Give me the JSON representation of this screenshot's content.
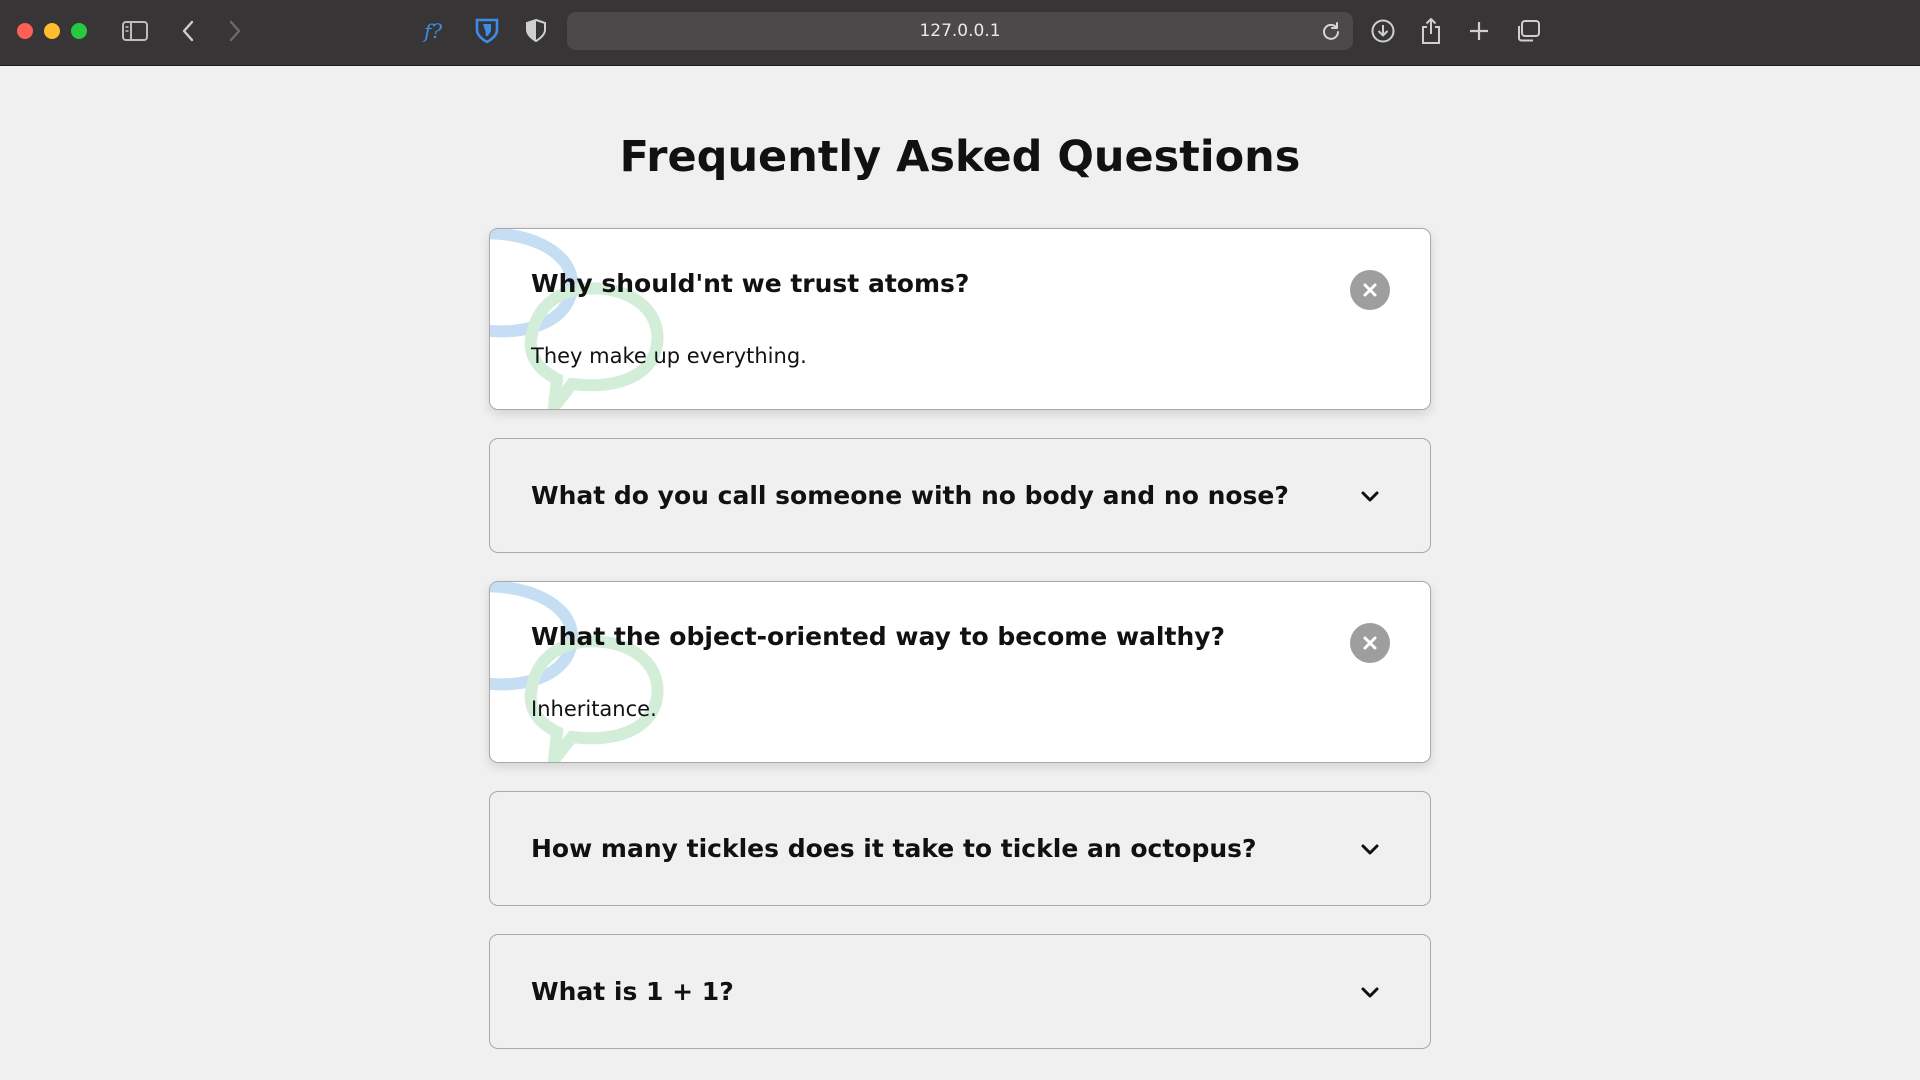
{
  "browser": {
    "url": "127.0.0.1",
    "colors": {
      "toolbar": "#383536",
      "address_bar": "#4c494a",
      "accent": "#2d7be0"
    }
  },
  "page": {
    "title": "Frequently Asked Questions"
  },
  "faqs": [
    {
      "question": "Why should'nt we trust atoms?",
      "answer": "They make up everything.",
      "open": true
    },
    {
      "question": "What do you call someone with no body and no nose?",
      "answer": "",
      "open": false
    },
    {
      "question": "What the object-oriented way to become walthy?",
      "answer": "Inheritance.",
      "open": true
    },
    {
      "question": "How many tickles does it take to tickle an octopus?",
      "answer": "",
      "open": false
    },
    {
      "question": "What is 1 + 1?",
      "answer": "",
      "open": false
    }
  ],
  "icons": {
    "close_toggle": "times-circle-icon",
    "open_toggle": "chevron-down-icon",
    "decoration": "chat-bubbles-icon"
  }
}
